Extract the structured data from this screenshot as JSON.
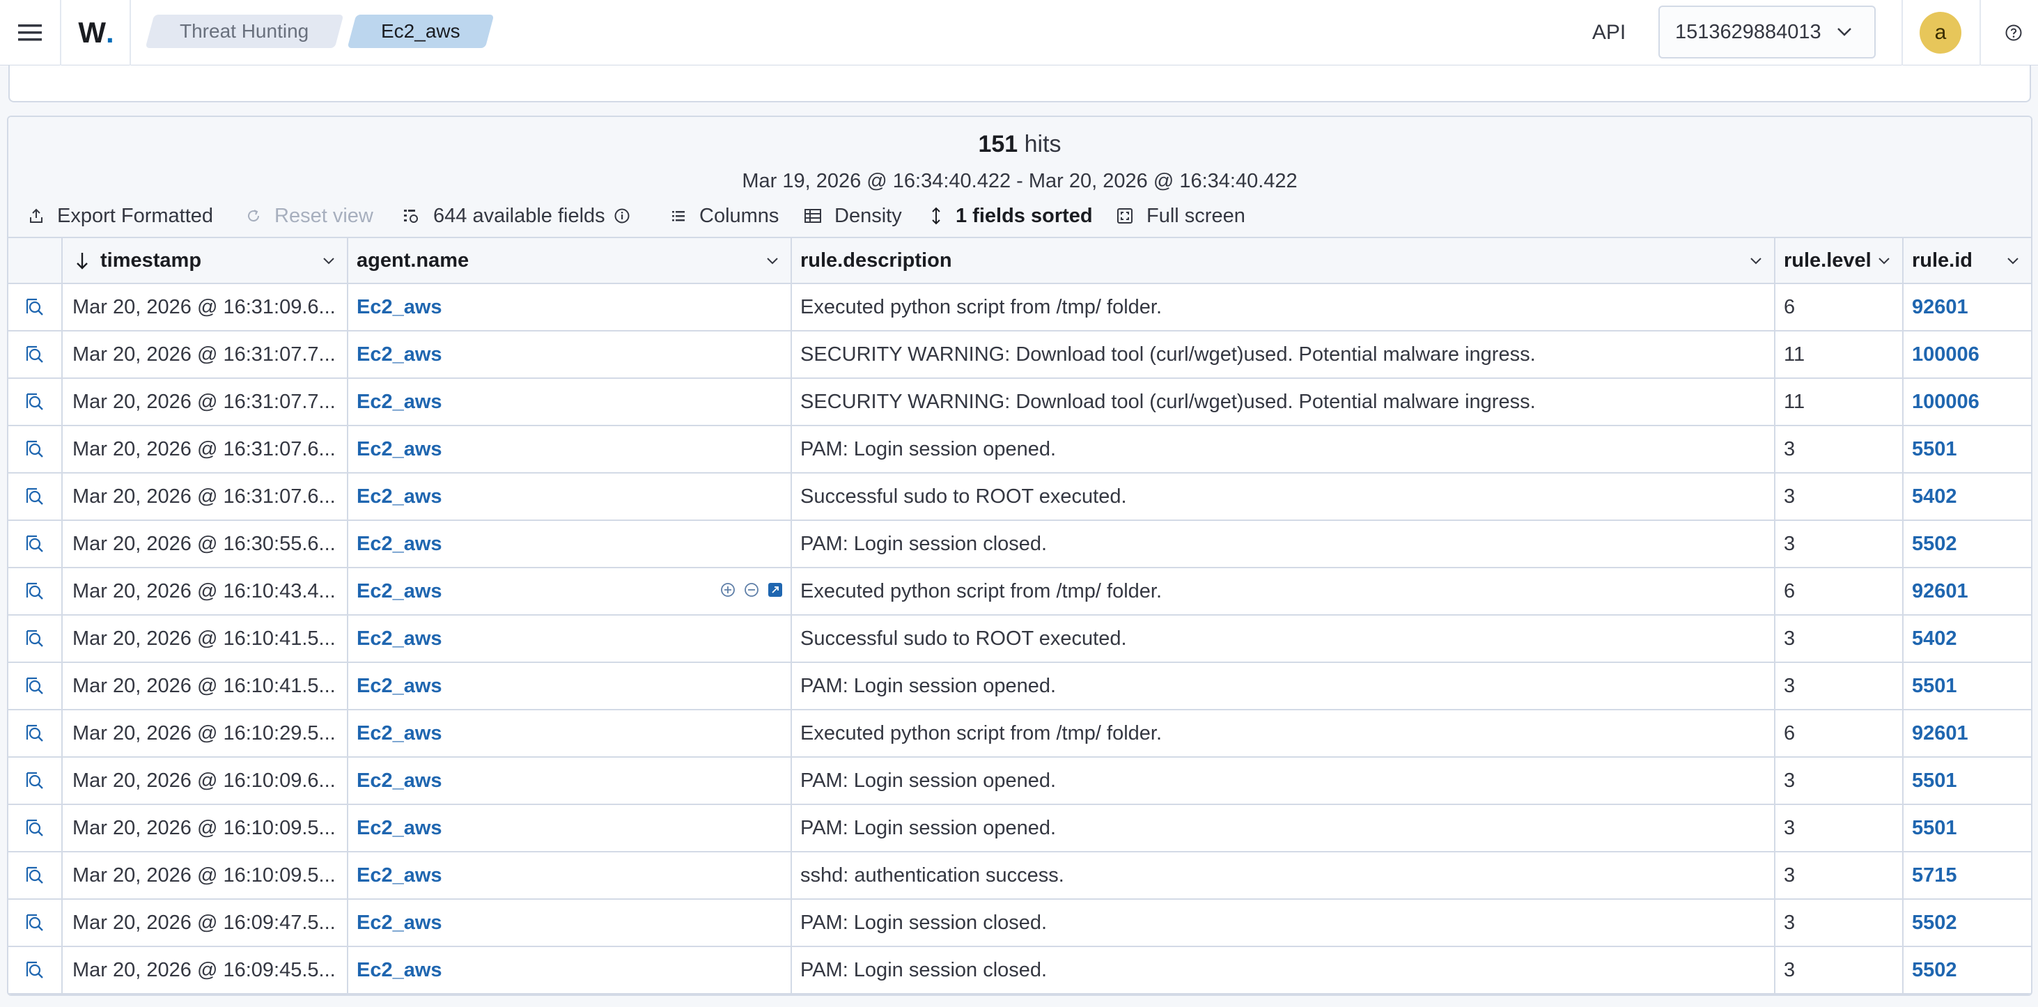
{
  "header": {
    "logo_text": "W",
    "breadcrumbs": [
      "Threat Hunting",
      "Ec2_aws"
    ],
    "api_label": "API",
    "tenant_value": "1513629884013",
    "avatar_letter": "a"
  },
  "results": {
    "hits_count": "151",
    "hits_label": "hits",
    "date_range": "Mar 19, 2026 @ 16:34:40.422 - Mar 20, 2026 @ 16:34:40.422",
    "toolbar": {
      "export": "Export Formatted",
      "reset": "Reset view",
      "fields": "644 available fields",
      "columns": "Columns",
      "density": "Density",
      "sorted": "1 fields sorted",
      "fullscreen": "Full screen"
    },
    "columns": [
      "timestamp",
      "agent.name",
      "rule.description",
      "rule.level",
      "rule.id"
    ],
    "rows": [
      {
        "timestamp": "Mar 20, 2026 @ 16:31:09.6...",
        "agent": "Ec2_aws",
        "description": "Executed python script from /tmp/ folder.",
        "level": "6",
        "id": "92601"
      },
      {
        "timestamp": "Mar 20, 2026 @ 16:31:07.7...",
        "agent": "Ec2_aws",
        "description": "SECURITY WARNING: Download tool (curl/wget)used. Potential malware ingress.",
        "level": "11",
        "id": "100006"
      },
      {
        "timestamp": "Mar 20, 2026 @ 16:31:07.7...",
        "agent": "Ec2_aws",
        "description": "SECURITY WARNING: Download tool (curl/wget)used. Potential malware ingress.",
        "level": "11",
        "id": "100006"
      },
      {
        "timestamp": "Mar 20, 2026 @ 16:31:07.6...",
        "agent": "Ec2_aws",
        "description": "PAM: Login session opened.",
        "level": "3",
        "id": "5501"
      },
      {
        "timestamp": "Mar 20, 2026 @ 16:31:07.6...",
        "agent": "Ec2_aws",
        "description": "Successful sudo to ROOT executed.",
        "level": "3",
        "id": "5402"
      },
      {
        "timestamp": "Mar 20, 2026 @ 16:30:55.6...",
        "agent": "Ec2_aws",
        "description": "PAM: Login session closed.",
        "level": "3",
        "id": "5502"
      },
      {
        "timestamp": "Mar 20, 2026 @ 16:10:43.4...",
        "agent": "Ec2_aws",
        "description": "Executed python script from /tmp/ folder.",
        "level": "6",
        "id": "92601"
      },
      {
        "timestamp": "Mar 20, 2026 @ 16:10:41.5...",
        "agent": "Ec2_aws",
        "description": "Successful sudo to ROOT executed.",
        "level": "3",
        "id": "5402"
      },
      {
        "timestamp": "Mar 20, 2026 @ 16:10:41.5...",
        "agent": "Ec2_aws",
        "description": "PAM: Login session opened.",
        "level": "3",
        "id": "5501"
      },
      {
        "timestamp": "Mar 20, 2026 @ 16:10:29.5...",
        "agent": "Ec2_aws",
        "description": "Executed python script from /tmp/ folder.",
        "level": "6",
        "id": "92601"
      },
      {
        "timestamp": "Mar 20, 2026 @ 16:10:09.6...",
        "agent": "Ec2_aws",
        "description": "PAM: Login session opened.",
        "level": "3",
        "id": "5501"
      },
      {
        "timestamp": "Mar 20, 2026 @ 16:10:09.5...",
        "agent": "Ec2_aws",
        "description": "PAM: Login session opened.",
        "level": "3",
        "id": "5501"
      },
      {
        "timestamp": "Mar 20, 2026 @ 16:10:09.5...",
        "agent": "Ec2_aws",
        "description": "sshd: authentication success.",
        "level": "3",
        "id": "5715"
      },
      {
        "timestamp": "Mar 20, 2026 @ 16:09:47.5...",
        "agent": "Ec2_aws",
        "description": "PAM: Login session closed.",
        "level": "3",
        "id": "5502"
      },
      {
        "timestamp": "Mar 20, 2026 @ 16:09:45.5...",
        "agent": "Ec2_aws",
        "description": "PAM: Login session closed.",
        "level": "3",
        "id": "5502"
      }
    ]
  },
  "colors": {
    "accent": "#1f66b0",
    "crumb_active": "#bcd6ee",
    "avatar": "#e7c65a"
  },
  "icons": [
    "menu-icon",
    "logo",
    "chevron-down-icon",
    "help-icon",
    "export-icon",
    "reset-icon",
    "fields-icon",
    "info-icon",
    "columns-icon",
    "density-icon",
    "sort-icon",
    "fullscreen-icon",
    "expand-row-icon",
    "filter-in-icon",
    "filter-out-icon",
    "toggle-column-icon"
  ]
}
